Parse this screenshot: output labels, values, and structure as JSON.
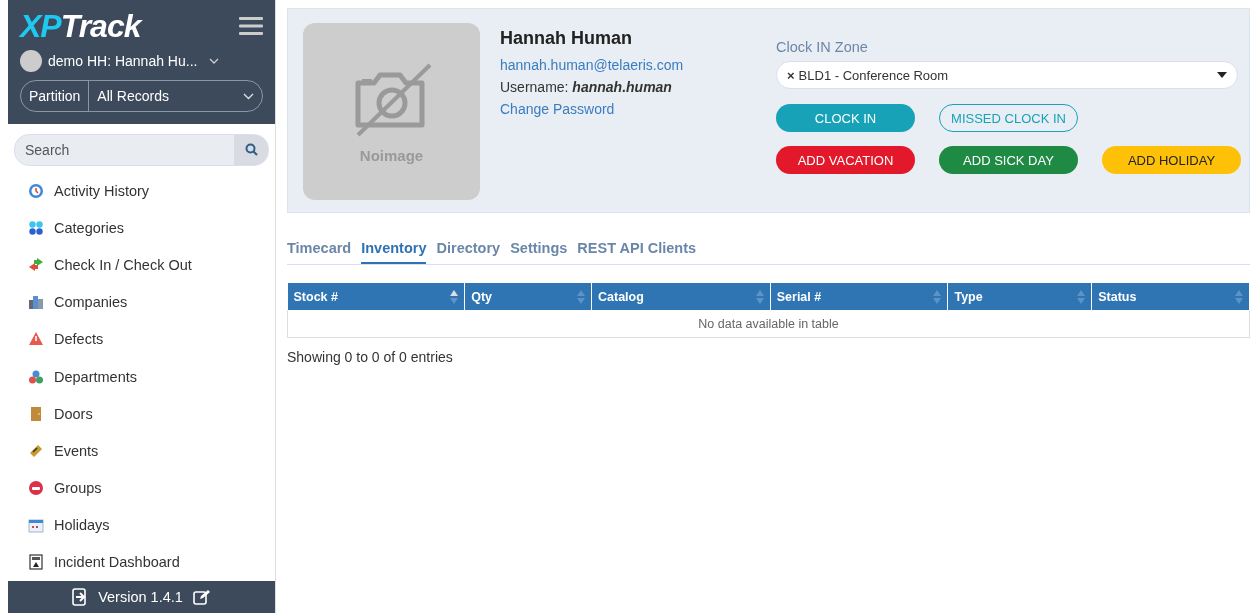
{
  "logo": {
    "part_1": "XP",
    "part_2": "Track"
  },
  "user_menu": {
    "label": "demo HH: Hannah Hu..."
  },
  "partition": {
    "label": "Partition",
    "value": "All Records"
  },
  "search": {
    "placeholder": "Search"
  },
  "sidebar": {
    "items": [
      {
        "label": "Activity History"
      },
      {
        "label": "Categories"
      },
      {
        "label": "Check In / Check Out"
      },
      {
        "label": "Companies"
      },
      {
        "label": "Defects"
      },
      {
        "label": "Departments"
      },
      {
        "label": "Doors"
      },
      {
        "label": "Events"
      },
      {
        "label": "Groups"
      },
      {
        "label": "Holidays"
      },
      {
        "label": "Incident Dashboard"
      }
    ]
  },
  "footer": {
    "version": "Version 1.4.1"
  },
  "profile": {
    "photo_text": "Noimage",
    "name": "Hannah Human",
    "email": "hannah.human@telaeris.com",
    "username_label": "Username:",
    "username": "hannah.human",
    "change_password": "Change Password"
  },
  "clock_zone": {
    "label": "Clock IN Zone",
    "clear": "×",
    "value": "BLD1 - Conference Room"
  },
  "actions": [
    {
      "label": "CLOCK IN",
      "kind": "primary"
    },
    {
      "label": "MISSED CLOCK IN",
      "kind": "outline"
    },
    {
      "label": "ADD VACATION",
      "kind": "danger"
    },
    {
      "label": "ADD SICK DAY",
      "kind": "success"
    },
    {
      "label": "ADD HOLIDAY",
      "kind": "warning"
    }
  ],
  "tabs": [
    {
      "label": "Timecard",
      "selected": false
    },
    {
      "label": "Inventory",
      "selected": true
    },
    {
      "label": "Directory",
      "selected": false
    },
    {
      "label": "Settings",
      "selected": false
    },
    {
      "label": "REST API Clients",
      "selected": false
    }
  ],
  "table": {
    "columns": [
      {
        "label": "Stock #",
        "sorted": true
      },
      {
        "label": "Qty",
        "sorted": false
      },
      {
        "label": "Catalog",
        "sorted": false
      },
      {
        "label": "Serial #",
        "sorted": false
      },
      {
        "label": "Type",
        "sorted": false
      },
      {
        "label": "Status",
        "sorted": false
      }
    ],
    "empty_message": "No data available in table"
  },
  "table_info": "Showing 0 to 0 of 0 entries"
}
